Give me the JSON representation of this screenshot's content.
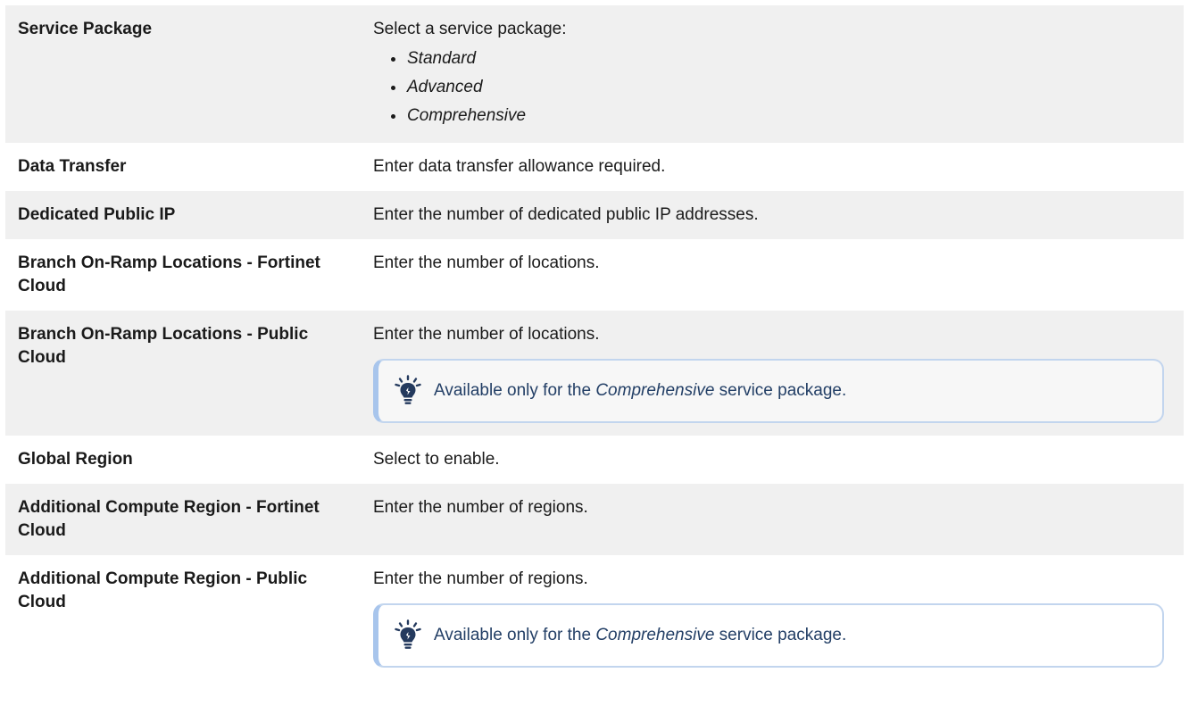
{
  "rows": [
    {
      "name": "Service Package",
      "description": "Select a service package:",
      "options": [
        "Standard",
        "Advanced",
        "Comprehensive"
      ]
    },
    {
      "name": "Data Transfer",
      "description": "Enter data transfer allowance required."
    },
    {
      "name": "Dedicated Public IP",
      "description": "Enter the number of dedicated public IP addresses."
    },
    {
      "name": "Branch On-Ramp Locations - Fortinet Cloud",
      "description": "Enter the number of locations."
    },
    {
      "name": "Branch On-Ramp Locations - Public Cloud",
      "description": "Enter the number of locations.",
      "note": {
        "prefix": "Available only for the ",
        "emphasis": "Comprehensive",
        "suffix": " service package.",
        "icon": "lightbulb-icon"
      }
    },
    {
      "name": "Global Region",
      "description": "Select to enable."
    },
    {
      "name": "Additional Compute Region - Fortinet Cloud",
      "description": "Enter the number of regions."
    },
    {
      "name": "Additional Compute Region - Public Cloud",
      "description": "Enter the number of regions.",
      "note": {
        "prefix": "Available only for the ",
        "emphasis": "Comprehensive",
        "suffix": " service package.",
        "icon": "lightbulb-icon"
      }
    }
  ],
  "colors": {
    "row_shade": "#f0f0f0",
    "note_border": "#c2d5ee",
    "note_accent": "#a8c5ec",
    "note_text": "#233f66",
    "icon_color": "#243a5e"
  }
}
